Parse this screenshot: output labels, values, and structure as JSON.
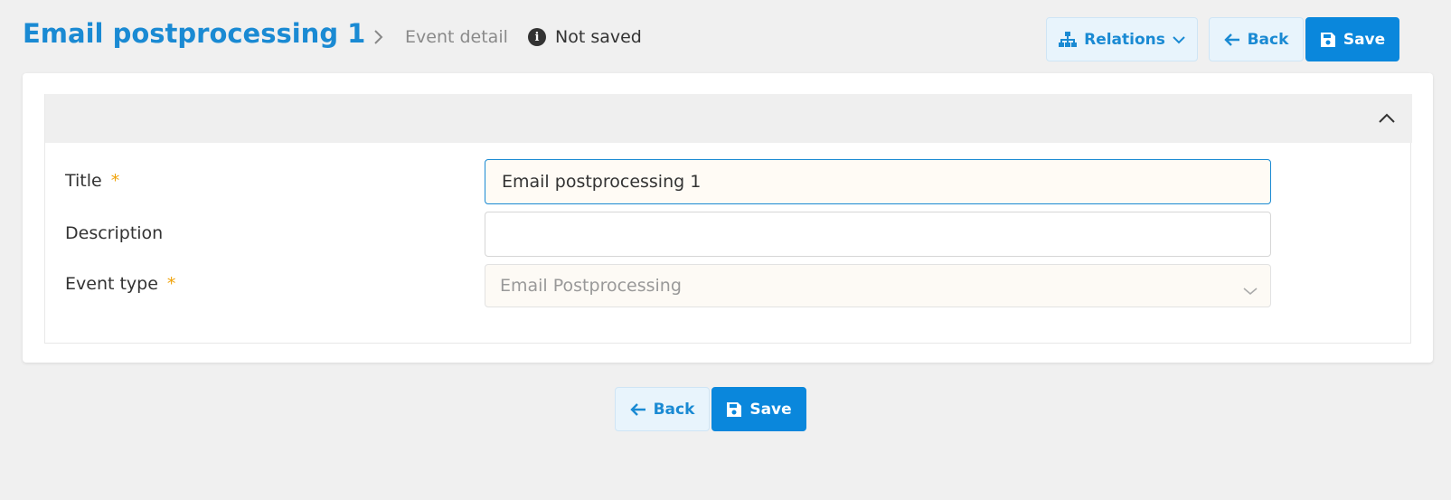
{
  "header": {
    "title": "Email postprocessing 1",
    "breadcrumb": "Event detail",
    "status": "Not saved"
  },
  "toolbar": {
    "relations_label": "Relations",
    "back_label": "Back",
    "save_label": "Save"
  },
  "form": {
    "title": {
      "label": "Title",
      "required_mark": "*",
      "value": "Email postprocessing 1"
    },
    "description": {
      "label": "Description",
      "value": ""
    },
    "event_type": {
      "label": "Event type",
      "required_mark": "*",
      "value": "Email Postprocessing"
    }
  },
  "footer": {
    "back_label": "Back",
    "save_label": "Save"
  },
  "colors": {
    "accent": "#1a8ad3",
    "primary_button": "#0a87dc",
    "required": "#f0a30a"
  },
  "icons": [
    "chevron-right-icon",
    "info-icon",
    "sitemap-icon",
    "chevron-down-icon",
    "arrow-left-icon",
    "floppy-disk-icon",
    "chevron-up-icon"
  ]
}
